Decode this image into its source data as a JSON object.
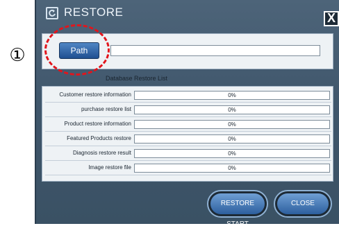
{
  "annotation": {
    "step_marker": "①"
  },
  "window": {
    "title": "RESTORE",
    "close_label": "X"
  },
  "path": {
    "button_label": "Path",
    "value": ""
  },
  "restore_list": {
    "title": "Database Restore List",
    "rows": [
      {
        "label": "Customer restore information",
        "progress": "0%"
      },
      {
        "label": "purchase restore list",
        "progress": "0%"
      },
      {
        "label": "Product restore information",
        "progress": "0%"
      },
      {
        "label": "Featured Products restore",
        "progress": "0%"
      },
      {
        "label": "Diagnosis restore result",
        "progress": "0%"
      },
      {
        "label": "Image restore file",
        "progress": "0%"
      }
    ]
  },
  "actions": {
    "start_label": "RESTORE START",
    "close_label": "CLOSE"
  },
  "colors": {
    "window_bg": "#3f566b",
    "button_blue": "#2d5f9e",
    "highlight": "#e2151c"
  }
}
